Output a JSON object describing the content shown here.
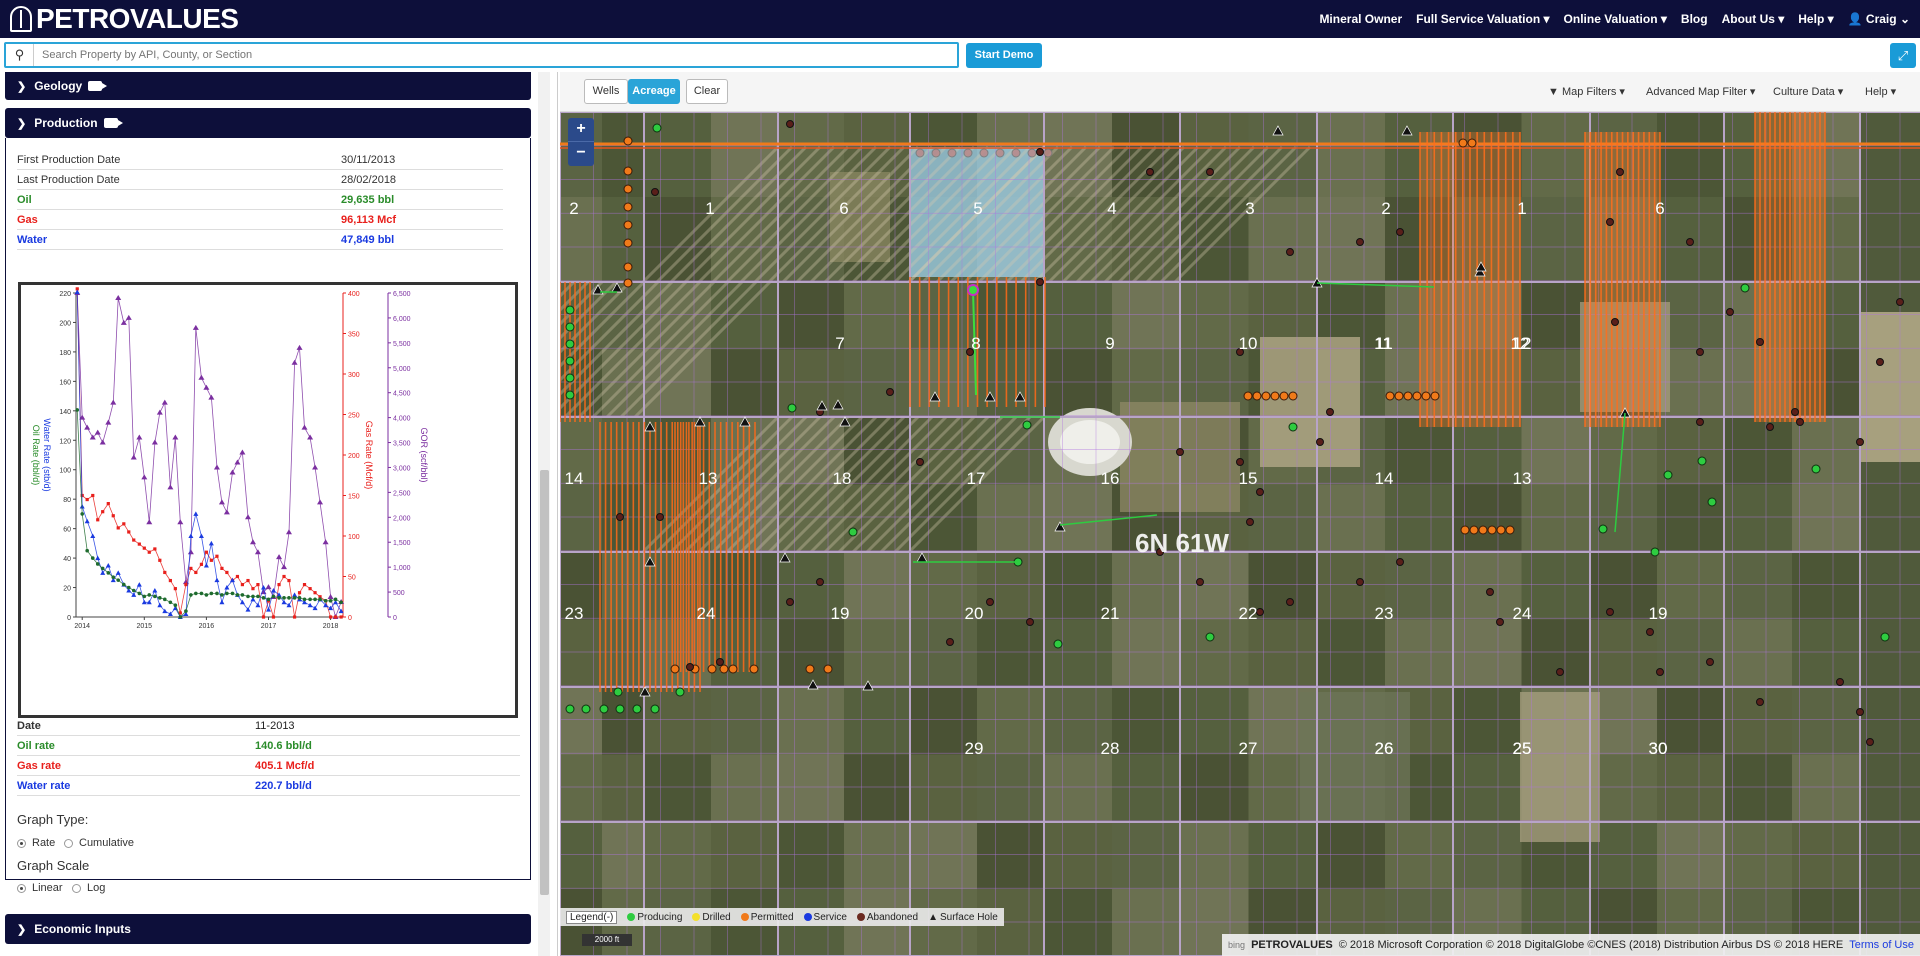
{
  "brand": {
    "name": "PETROVALUES"
  },
  "nav": {
    "items": [
      "Mineral Owner",
      "Full Service Valuation ▾",
      "Online Valuation ▾",
      "Blog",
      "About Us ▾",
      "Help ▾"
    ],
    "user": "Craig"
  },
  "search": {
    "placeholder": "Search Property by API, County, or Section",
    "demo_label": "Start Demo"
  },
  "sections": {
    "geology": "Geology",
    "production": "Production",
    "economic": "Economic Inputs"
  },
  "production": {
    "summary": [
      {
        "label": "First Production Date",
        "value": "30/11/2013"
      },
      {
        "label": "Last Production Date",
        "value": "28/02/2018"
      },
      {
        "label": "Oil",
        "value": "29,635 bbl"
      },
      {
        "label": "Gas",
        "value": "96,113 Mcf"
      },
      {
        "label": "Water",
        "value": "47,849 bbl"
      }
    ],
    "detail": [
      {
        "label": "Date",
        "value": "11-2013"
      },
      {
        "label": "Oil rate",
        "value": "140.6 bbl/d"
      },
      {
        "label": "Gas rate",
        "value": "405.1 Mcf/d"
      },
      {
        "label": "Water rate",
        "value": "220.7 bbl/d"
      }
    ],
    "graph_type": {
      "label": "Graph Type:",
      "options": [
        "Rate",
        "Cumulative"
      ],
      "selected": "Rate"
    },
    "graph_scale": {
      "label": "Graph Scale",
      "options": [
        "Linear",
        "Log"
      ],
      "selected": "Linear"
    }
  },
  "chart_data": {
    "type": "line",
    "x_ticks": [
      "2014",
      "2015",
      "2016",
      "2017",
      "2018"
    ],
    "ylabel_left": "Oil Rate (bbl/d)",
    "ylabel_left2": "Water Rate (stb/d)",
    "ylabel_right1": "Gas Rate (Mcf/d)",
    "ylabel_right2": "GOR (scf/bbl)",
    "y_left_ticks": [
      0,
      20,
      40,
      60,
      80,
      100,
      120,
      140,
      160,
      180,
      200,
      220
    ],
    "y_right1_ticks": [
      0,
      50,
      100,
      150,
      200,
      250,
      300,
      350,
      400
    ],
    "y_right2_ticks": [
      0,
      500,
      1000,
      1500,
      2000,
      2500,
      3000,
      3500,
      4000,
      4500,
      5000,
      5500,
      6000,
      6500
    ],
    "ylim_left": [
      0,
      220
    ],
    "ylim_right1": [
      0,
      400
    ],
    "ylim_right2": [
      0,
      6500
    ],
    "x": [
      2013.92,
      2014.0,
      2014.08,
      2014.17,
      2014.25,
      2014.33,
      2014.42,
      2014.5,
      2014.58,
      2014.67,
      2014.75,
      2014.83,
      2014.92,
      2015.0,
      2015.08,
      2015.17,
      2015.25,
      2015.33,
      2015.42,
      2015.5,
      2015.58,
      2015.67,
      2015.75,
      2015.83,
      2015.92,
      2016.0,
      2016.08,
      2016.17,
      2016.25,
      2016.33,
      2016.42,
      2016.5,
      2016.58,
      2016.67,
      2016.75,
      2016.83,
      2016.92,
      2017.0,
      2017.08,
      2017.17,
      2017.25,
      2017.33,
      2017.42,
      2017.5,
      2017.58,
      2017.67,
      2017.75,
      2017.83,
      2017.92,
      2018.0,
      2018.08,
      2018.17
    ],
    "series": [
      {
        "name": "Oil rate",
        "color": "#1e6b2e",
        "values": [
          140.6,
          70,
          45,
          40,
          36,
          33,
          30,
          27,
          25,
          22,
          20,
          18,
          16,
          14,
          15,
          14,
          13,
          12,
          10,
          8,
          0,
          4,
          15,
          16,
          16,
          15,
          16,
          16,
          15,
          16,
          16,
          15,
          15,
          14,
          14,
          14,
          13,
          12,
          14,
          13,
          13,
          13,
          13,
          13,
          12,
          12,
          12,
          12,
          11,
          11,
          12,
          10
        ]
      },
      {
        "name": "Water rate",
        "color": "#1a3ae0",
        "values": [
          220.7,
          75,
          65,
          55,
          40,
          30,
          35,
          25,
          30,
          22,
          18,
          15,
          22,
          10,
          10,
          18,
          8,
          4,
          2,
          6,
          0,
          2,
          55,
          70,
          55,
          35,
          50,
          25,
          10,
          20,
          25,
          15,
          10,
          5,
          12,
          8,
          20,
          5,
          18,
          15,
          10,
          8,
          15,
          12,
          10,
          8,
          6,
          12,
          8,
          6,
          10,
          4
        ]
      },
      {
        "name": "Gas rate",
        "color": "#e8201c",
        "values": [
          405.1,
          150,
          145,
          150,
          120,
          130,
          140,
          125,
          110,
          115,
          105,
          95,
          90,
          85,
          80,
          84,
          70,
          55,
          45,
          35,
          5,
          40,
          60,
          55,
          65,
          80,
          70,
          75,
          60,
          55,
          45,
          50,
          40,
          45,
          35,
          40,
          0,
          20,
          0,
          40,
          50,
          45,
          0,
          30,
          40,
          35,
          30,
          25,
          20,
          0,
          0,
          0
        ]
      },
      {
        "name": "GOR",
        "color": "#7b2fa0",
        "values": [
          6500,
          4000,
          3800,
          3600,
          3700,
          3500,
          3900,
          4300,
          6400,
          5900,
          6000,
          3200,
          3600,
          2800,
          1900,
          3500,
          4100,
          4300,
          2600,
          3600,
          1900,
          700,
          1300,
          5800,
          4800,
          4600,
          4400,
          3000,
          2300,
          2100,
          2900,
          3100,
          3300,
          2000,
          1500,
          1300,
          500,
          600,
          400,
          1200,
          1000,
          1700,
          5100,
          5400,
          3800,
          3600,
          3000,
          2300,
          1500,
          400,
          0,
          300
        ]
      }
    ]
  },
  "map": {
    "toolbar": {
      "wells": "Wells",
      "acreage": "Acreage",
      "clear": "Clear",
      "map_filters": "Map Filters ▾",
      "advanced_filter": "Advanced Map Filter ▾",
      "culture": "Culture Data ▾",
      "help": "Help ▾"
    },
    "township_label": "6N 61W",
    "sections": [
      "2",
      "1",
      "6",
      "5",
      "4",
      "3",
      "2",
      "1",
      "6",
      "11",
      "12",
      "7",
      "8",
      "9",
      "10",
      "11",
      "12",
      "14",
      "13",
      "18",
      "17",
      "16",
      "15",
      "14",
      "13",
      "23",
      "24",
      "19",
      "20",
      "21",
      "22",
      "23",
      "24",
      "19",
      "26",
      "25",
      "30",
      "29",
      "28",
      "27",
      "26",
      "25",
      "30"
    ],
    "legend": {
      "title": "Legend(-)",
      "items": [
        {
          "label": "Producing",
          "color": "#2ecc40"
        },
        {
          "label": "Drilled",
          "color": "#f4e02a"
        },
        {
          "label": "Permitted",
          "color": "#f07a1a"
        },
        {
          "label": "Service",
          "color": "#1a3ae0"
        },
        {
          "label": "Abandoned",
          "color": "#6b2a20"
        },
        {
          "label": "Surface Hole",
          "color": "#222"
        }
      ]
    },
    "scale": "2000 ft",
    "attribution": "© 2018 Microsoft Corporation © 2018 DigitalGlobe ©CNES (2018) Distribution Airbus DS © 2018 HERE",
    "attribution_brand": "PETROVALUES",
    "terms": "Terms of Use",
    "bing": "bing"
  }
}
